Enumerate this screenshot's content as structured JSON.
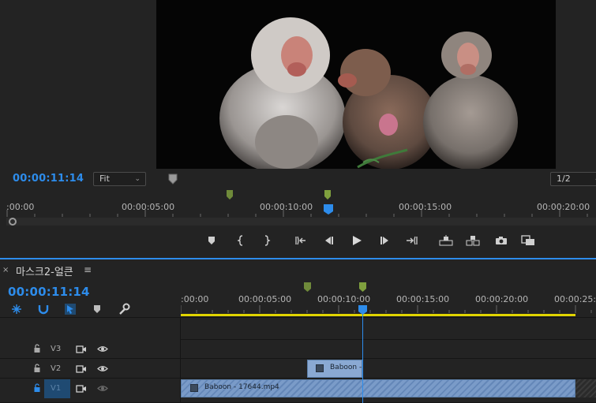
{
  "monitor": {
    "timecode": "00:00:11:14",
    "fit_select": "Fit",
    "resolution_select": "1/2",
    "ruler_labels": [
      ":00:00",
      "00:00:05:00",
      "00:00:10:00",
      "00:00:15:00",
      "00:00:20:00"
    ],
    "transport_buttons": [
      "add-marker",
      "mark-in",
      "mark-out",
      "go-to-in",
      "step-back",
      "play",
      "step-forward",
      "go-to-out",
      "lift",
      "extract",
      "export-frame",
      "compare-view"
    ]
  },
  "timeline": {
    "tab_title": "마스크2-얼큰",
    "tab_close": "×",
    "tab_menu": "≡",
    "timecode": "00:00:11:14",
    "ruler_labels": [
      ":00:00",
      "00:00:05:00",
      "00:00:10:00",
      "00:00:15:00",
      "00:00:20:00",
      "00:00:25:00"
    ],
    "tracks": [
      {
        "name": "V3"
      },
      {
        "name": "V2"
      },
      {
        "name": "V1"
      }
    ],
    "clips": {
      "v2": "Baboon -",
      "v1": "Baboon - 17644.mp4"
    }
  },
  "colors": {
    "accent": "#2d8ceb",
    "work_area": "#e1d400",
    "marker": "#6f8a3a",
    "clip": "#8aa9d3"
  }
}
